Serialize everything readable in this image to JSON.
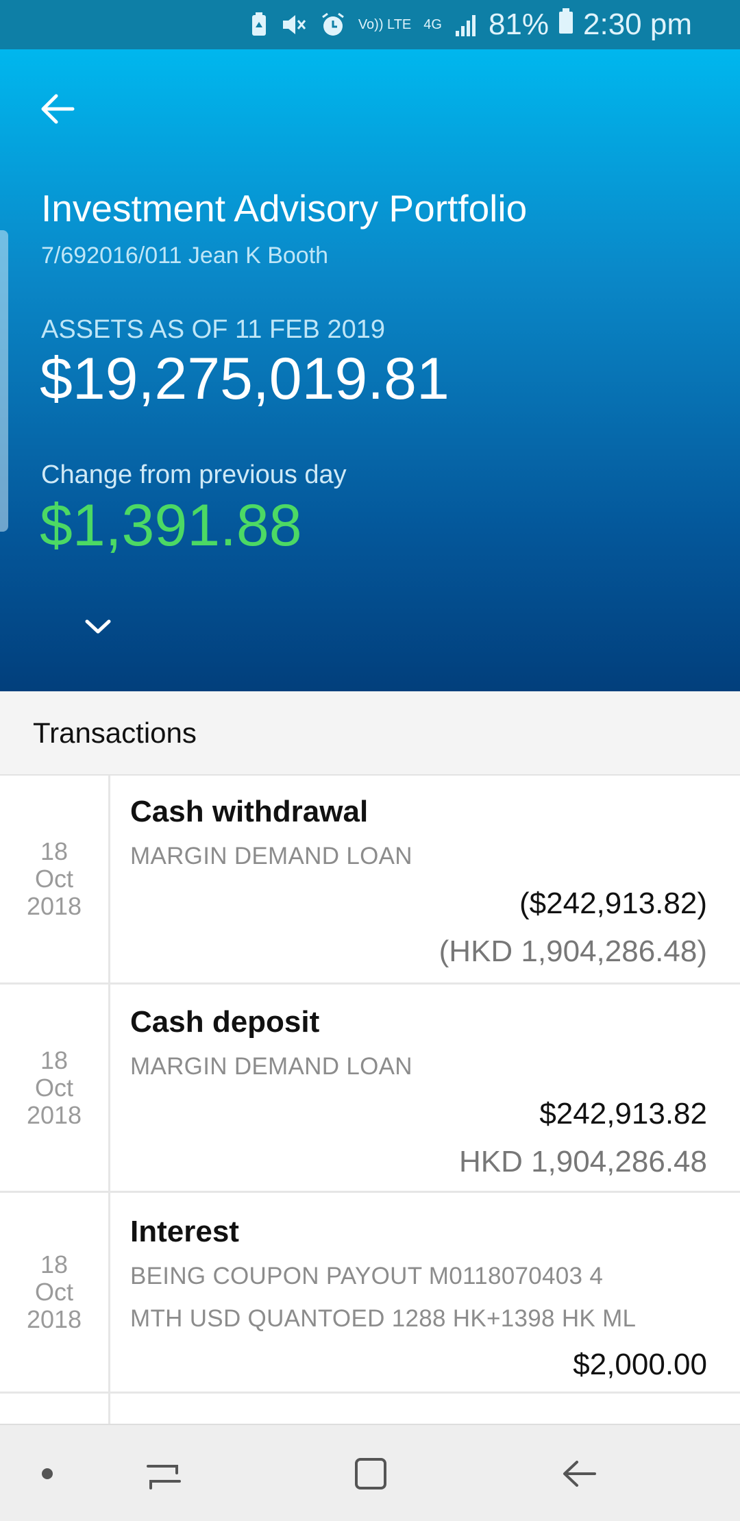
{
  "status_bar": {
    "icons": [
      "battery-saver-icon",
      "mute-icon",
      "alarm-icon",
      "volte-icon",
      "4g-icon",
      "signal-icon",
      "battery-icon"
    ],
    "volte_label": "Vo)) LTE",
    "network_label": "4G",
    "battery_percent": "81%",
    "time": "2:30 pm"
  },
  "header": {
    "title": "Investment Advisory Portfolio",
    "account": "7/692016/011 Jean K Booth",
    "assets_label": "ASSETS AS OF 11 FEB 2019",
    "assets_value": "$19,275,019.81",
    "change_label": "Change from previous day",
    "change_value": "$1,391.88",
    "change_color": "#4cd964"
  },
  "transactions": {
    "title": "Transactions",
    "items": [
      {
        "date_day": "18",
        "date_month": "Oct",
        "date_year": "2018",
        "title": "Cash withdrawal",
        "desc1": "MARGIN DEMAND LOAN",
        "desc2": "",
        "amount": "($242,913.82)",
        "amount_local": "(HKD 1,904,286.48)"
      },
      {
        "date_day": "18",
        "date_month": "Oct",
        "date_year": "2018",
        "title": "Cash deposit",
        "desc1": "MARGIN DEMAND LOAN",
        "desc2": "",
        "amount": "$242,913.82",
        "amount_local": "HKD 1,904,286.48"
      },
      {
        "date_day": "18",
        "date_month": "Oct",
        "date_year": "2018",
        "title": "Interest",
        "desc1": "BEING COUPON PAYOUT M0118070403  4",
        "desc2": "MTH USD QUANTOED 1288 HK+1398 HK ML",
        "amount": "$2,000.00",
        "amount_local": ""
      }
    ]
  },
  "nav_bar": {
    "buttons": [
      "nav-dot-icon",
      "recent-apps-icon",
      "home-icon",
      "back-icon"
    ]
  },
  "colors": {
    "status_bar": "#0e7fa6",
    "header_top": "#00b7ee",
    "header_bottom": "#023f7c",
    "positive": "#4cd964"
  }
}
